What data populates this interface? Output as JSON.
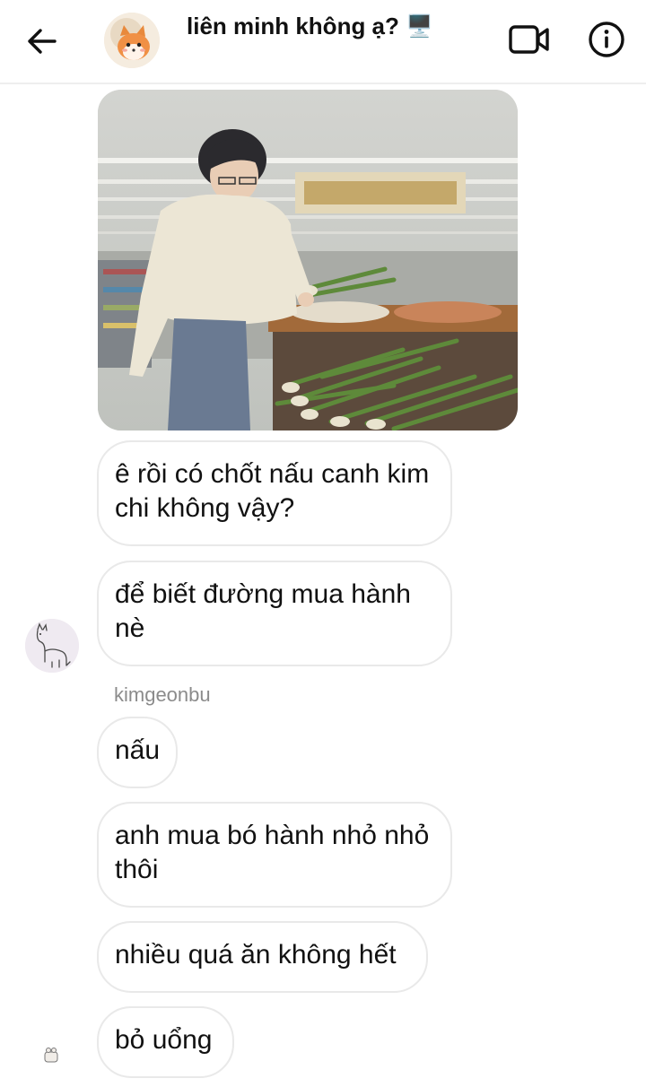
{
  "header": {
    "title": "liên minh không ạ?",
    "title_emoji": "🖥️",
    "back_icon": "arrow-left-icon",
    "video_icon": "video-camera-icon",
    "info_icon": "info-icon"
  },
  "messages": [
    {
      "text": "ê rồi có chốt nấu canh kim chi không vậy?"
    },
    {
      "text": "để biết đường mua hành nè"
    },
    {
      "text": "nấu"
    },
    {
      "text": "anh mua bó hành nhỏ nhỏ thôi"
    },
    {
      "text": "nhiều quá ăn không hết"
    },
    {
      "text": "bỏ uổng"
    }
  ],
  "sender_label": "kimgeonbu",
  "colors": {
    "bubble_border": "#e9e9e9",
    "sender_label": "#8b8b8b",
    "header_divider": "#eeeeee"
  }
}
